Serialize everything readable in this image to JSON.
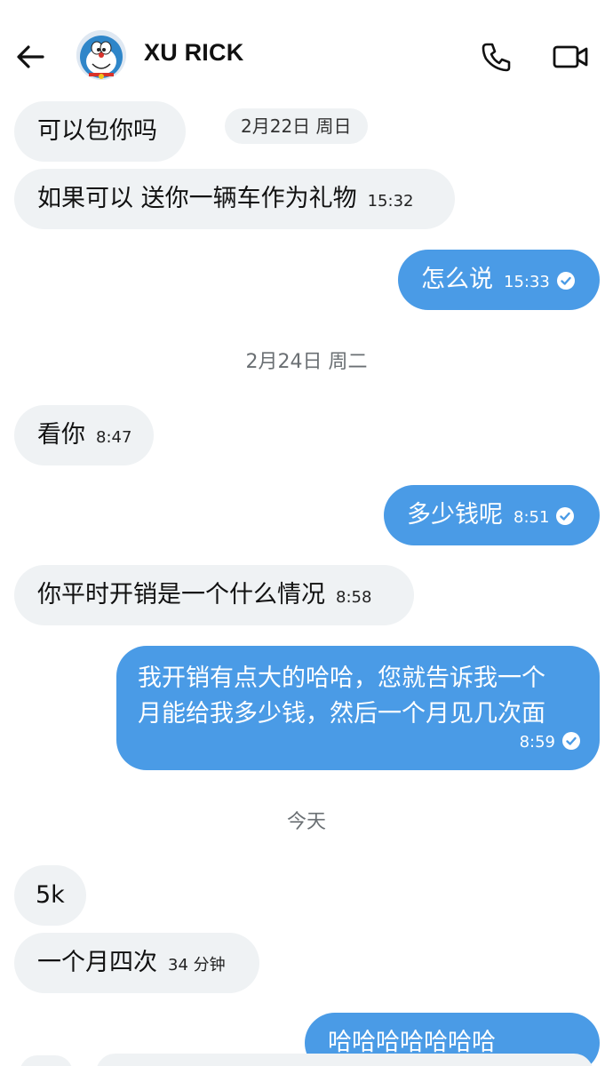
{
  "header": {
    "back_icon": "arrow-left-icon",
    "avatar_alt": "doraemon-avatar",
    "contact_name": "XU RICK",
    "call_icon": "phone-icon",
    "video_icon": "video-camera-icon"
  },
  "messages": [
    {
      "id": "m1",
      "dir": "in",
      "text": "可以包你吗",
      "time": ""
    },
    {
      "id": "m2",
      "dir": "in",
      "text": "如果可以 送你一辆车作为礼物",
      "time": "15:32"
    },
    {
      "id": "m3",
      "dir": "out",
      "text": "怎么说",
      "time": "15:33"
    },
    {
      "id": "m4",
      "dir": "in",
      "text": "看你",
      "time": "8:47"
    },
    {
      "id": "m5",
      "dir": "out",
      "text": "多少钱呢",
      "time": "8:51"
    },
    {
      "id": "m6",
      "dir": "in",
      "text": "你平时开销是一个什么情况",
      "time": "8:58"
    },
    {
      "id": "m7",
      "dir": "out",
      "text_lines": [
        "我开销有点大的哈哈，您就告诉我一个",
        "月能给我多少钱，然后一个月见几次面"
      ],
      "time": "8:59"
    },
    {
      "id": "m8",
      "dir": "in",
      "text": "5k",
      "time": ""
    },
    {
      "id": "m9",
      "dir": "in",
      "text": "一个月四次",
      "time": "34 分钟"
    },
    {
      "id": "m10",
      "dir": "out",
      "text": "哈哈哈哈哈哈哈",
      "time": ""
    }
  ],
  "date_labels": {
    "d1": "2月22日 周日",
    "d2": "2月24日 周二",
    "d3": "今天"
  },
  "colors": {
    "outgoing_bubble": "#4a9be6",
    "incoming_bubble": "#eff2f4",
    "header_text": "#111111"
  }
}
